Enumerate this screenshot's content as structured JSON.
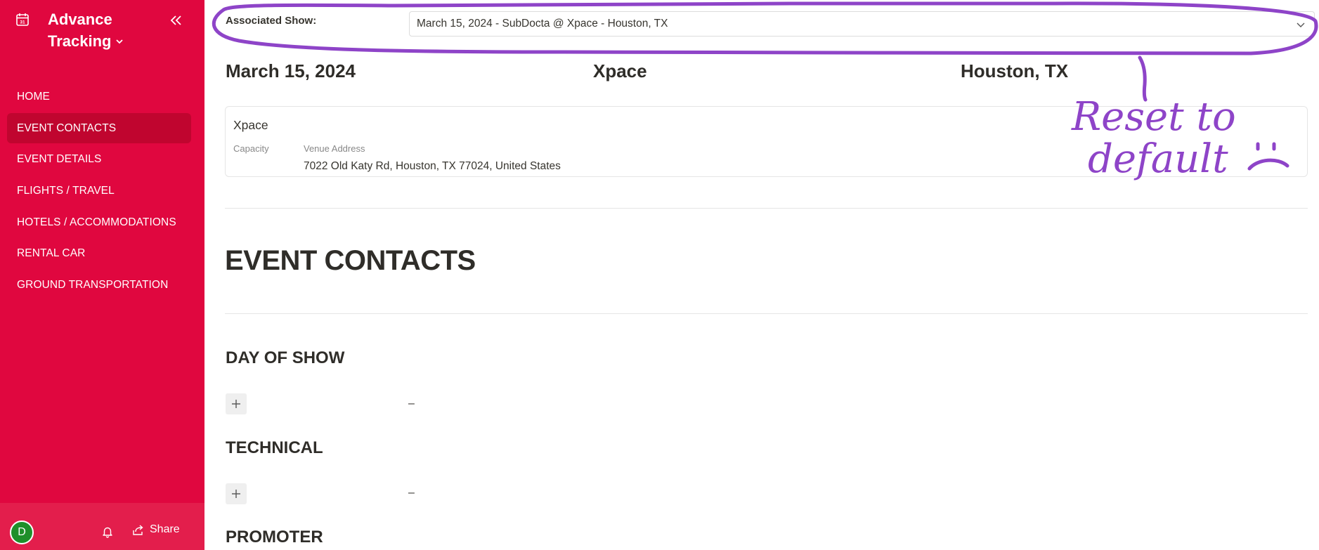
{
  "sidebar": {
    "title_line1": "Advance",
    "title_line2": "Tracking",
    "items": [
      {
        "label": "HOME"
      },
      {
        "label": "EVENT CONTACTS",
        "active": true
      },
      {
        "label": "EVENT DETAILS"
      },
      {
        "label": "FLIGHTS / TRAVEL"
      },
      {
        "label": "HOTELS / ACCOMMODATIONS"
      },
      {
        "label": "RENTAL CAR"
      },
      {
        "label": "GROUND TRANSPORTATION"
      }
    ],
    "footer": {
      "avatar_letter": "D",
      "share_label": "Share",
      "avatar_color": "#1f8f2a"
    },
    "color": "#e0073f",
    "active_color": "#c0052f"
  },
  "header": {
    "assoc_label": "Associated Show:",
    "selected_show": "March 15, 2024 - SubDocta @ Xpace - Houston, TX"
  },
  "show_info": {
    "date": "March 15, 2024",
    "venue": "Xpace",
    "city": "Houston, TX"
  },
  "venue_card": {
    "name": "Xpace",
    "capacity_label": "Capacity",
    "address_label": "Venue Address",
    "address": "7022 Old Katy Rd, Houston, TX 77024, United States"
  },
  "page": {
    "section_title": "EVENT CONTACTS",
    "subsections": [
      {
        "title": "DAY OF SHOW",
        "value": "–"
      },
      {
        "title": "TECHNICAL",
        "value": "–"
      },
      {
        "title": "PROMOTER"
      }
    ]
  },
  "annotation": {
    "text_line1": "Reset to",
    "text_line2": "default",
    "color": "#8e44c8"
  }
}
